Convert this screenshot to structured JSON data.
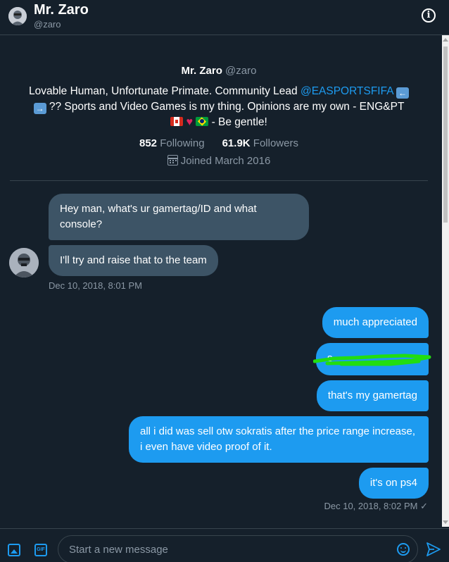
{
  "header": {
    "name": "Mr. Zaro",
    "handle": "@zaro",
    "info_icon": "info-icon",
    "info_glyph": "i"
  },
  "profile": {
    "name": "Mr. Zaro",
    "handle": "@zaro",
    "bio_part1": "Lovable Human, Unfortunate Primate. Community Lead ",
    "bio_mention": "@EASPORTSFIFA",
    "bio_part2": " ?? Sports and Video Games is my thing. Opinions are my own - ENG&PT",
    "bio_part3": " - Be gentle!",
    "following_count": "852",
    "following_label": "Following",
    "followers_count": "61.9K",
    "followers_label": "Followers",
    "joined": "Joined March 2016"
  },
  "messages": [
    {
      "side": "received",
      "text": "Hey man, what's ur gamertag/ID and what console?"
    },
    {
      "side": "received",
      "text": "I'll try and raise that to the team"
    },
    {
      "side": "sent",
      "text": "much appreciated"
    },
    {
      "side": "sent",
      "text": "s"
    },
    {
      "side": "sent",
      "text": "that's my gamertag"
    },
    {
      "side": "sent",
      "text": "all i did was sell otw sokratis after the price range increase, i even have video proof of it."
    },
    {
      "side": "sent",
      "text": "it's on ps4"
    }
  ],
  "timestamps": {
    "received": "Dec 10, 2018, 8:01 PM",
    "sent": "Dec 10, 2018, 8:02 PM",
    "sent_check": "✓"
  },
  "composer": {
    "placeholder": "Start a new message",
    "gif_label": "GIF"
  },
  "colors": {
    "background": "#15202b",
    "sent_bubble": "#1d9bf0",
    "received_bubble": "#3d5466",
    "scribble": "#22dd11",
    "accent": "#1d9bf0"
  }
}
